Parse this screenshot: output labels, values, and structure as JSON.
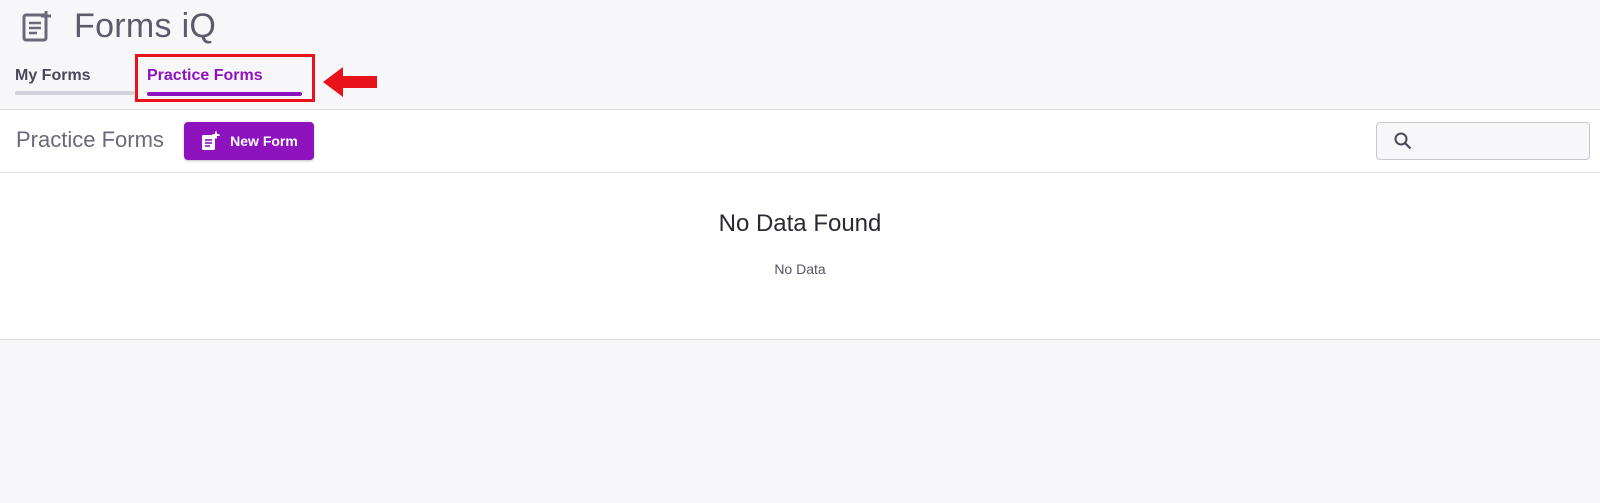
{
  "app": {
    "title": "Forms iQ",
    "icon": "form-add-icon"
  },
  "tabs": [
    {
      "label": "My Forms",
      "active": false
    },
    {
      "label": "Practice Forms",
      "active": true
    }
  ],
  "toolbar": {
    "section_title": "Practice Forms",
    "new_form_label": "New Form",
    "search_placeholder": ""
  },
  "empty_state": {
    "title": "No Data Found",
    "subtitle": "No Data"
  },
  "colors": {
    "accent": "#8e12be",
    "annotation": "#e8121b",
    "background": "#f7f6f9"
  }
}
